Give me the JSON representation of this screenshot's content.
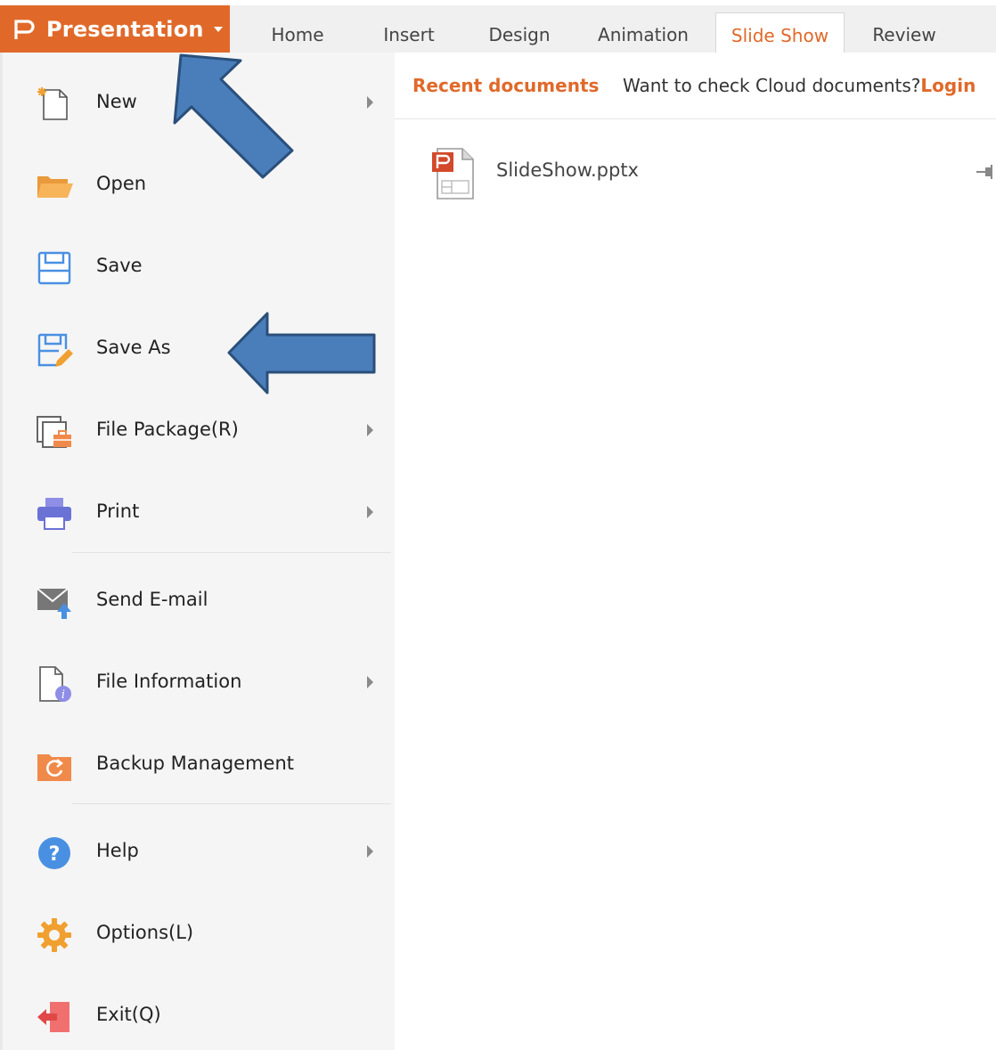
{
  "app_button": {
    "label": "Presentation",
    "logo_icon": "presentation-p-icon"
  },
  "ribbon_tabs": [
    {
      "label": "Home"
    },
    {
      "label": "Insert"
    },
    {
      "label": "Design"
    },
    {
      "label": "Animation"
    },
    {
      "label": "Slide Show",
      "active": true
    },
    {
      "label": "Review"
    }
  ],
  "menu": {
    "items": [
      {
        "label": "New",
        "icon": "new-document-icon",
        "has_submenu": true
      },
      {
        "label": "Open",
        "icon": "open-folder-icon",
        "has_submenu": false
      },
      {
        "label": "Save",
        "icon": "save-floppy-icon",
        "has_submenu": false
      },
      {
        "label": "Save As",
        "icon": "save-as-pencil-icon",
        "has_submenu": false
      },
      {
        "label": "File Package(R)",
        "icon": "file-package-icon",
        "has_submenu": true
      },
      {
        "label": "Print",
        "icon": "printer-icon",
        "has_submenu": true
      },
      {
        "label": "Send E-mail",
        "icon": "mail-send-icon",
        "has_submenu": false
      },
      {
        "label": "File Information",
        "icon": "file-info-icon",
        "has_submenu": true
      },
      {
        "label": "Backup Management",
        "icon": "backup-folder-icon",
        "has_submenu": false
      },
      {
        "label": "Help",
        "icon": "help-question-icon",
        "has_submenu": true
      },
      {
        "label": "Options(L)",
        "icon": "gear-icon",
        "has_submenu": false
      },
      {
        "label": "Exit(Q)",
        "icon": "exit-icon",
        "has_submenu": false
      }
    ]
  },
  "content": {
    "recent_label": "Recent documents",
    "cloud_prompt": "Want to check Cloud documents?",
    "login_label": "Login",
    "recent_files": [
      {
        "name": "SlideShow.pptx",
        "icon": "pptx-file-icon",
        "pin_icon": "pin-icon"
      }
    ]
  },
  "colors": {
    "accent": "#e0692a",
    "menu_bg": "#f5f5f5",
    "annotation_arrow_fill": "#4a7ebb",
    "annotation_arrow_stroke": "#2a4f7a"
  }
}
